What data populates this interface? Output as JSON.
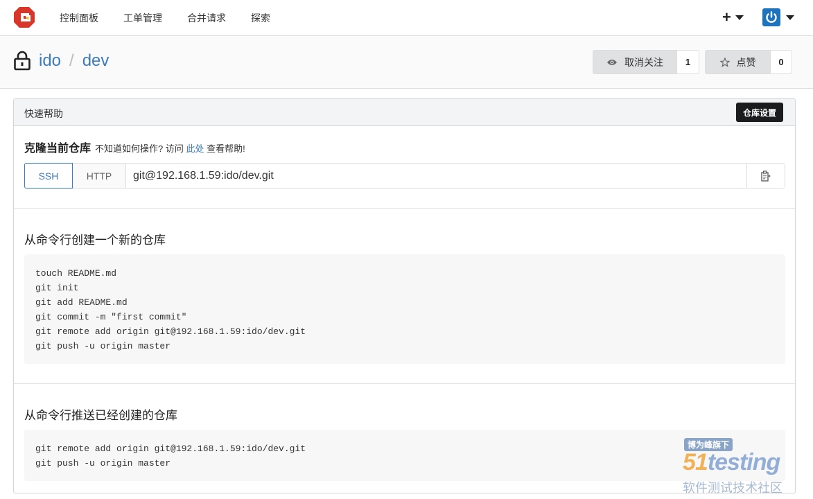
{
  "nav": {
    "items": [
      "控制面板",
      "工单管理",
      "合并请求",
      "探索"
    ],
    "plus_label": "+"
  },
  "repo": {
    "owner": "ido",
    "separator": "/",
    "name": "dev",
    "watch_label": "取消关注",
    "watch_count": "1",
    "star_label": "点赞",
    "star_count": "0"
  },
  "quick_help": {
    "title": "快速帮助",
    "settings_label": "仓库设置",
    "clone_title": "克隆当前仓库",
    "help_prefix": "不知道如何操作? 访问",
    "help_link": "此处",
    "help_suffix": "查看帮助!",
    "tab_ssh": "SSH",
    "tab_http": "HTTP",
    "clone_url": "git@192.168.1.59:ido/dev.git"
  },
  "sections": [
    {
      "title": "从命令行创建一个新的仓库",
      "code": "touch README.md\ngit init\ngit add README.md\ngit commit -m \"first commit\"\ngit remote add origin git@192.168.1.59:ido/dev.git\ngit push -u origin master"
    },
    {
      "title": "从命令行推送已经创建的仓库",
      "code": "git remote add origin git@192.168.1.59:ido/dev.git\ngit push -u origin master"
    }
  ],
  "watermark": {
    "tag": "博为峰旗下",
    "brand_num": "51",
    "brand_text": "testing",
    "sub": "软件测试技术社区"
  },
  "colors": {
    "accent": "#3b7bbf",
    "logo": "#d9362b",
    "dark_button": "#1b1c1d"
  }
}
